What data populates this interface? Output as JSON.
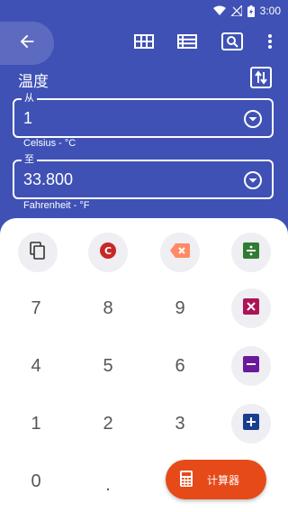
{
  "status": {
    "time": "3:00"
  },
  "title": "温度",
  "from": {
    "legend": "从",
    "value": "1",
    "unit": "Celsius - °C"
  },
  "to": {
    "legend": "至",
    "value": "33.800",
    "unit": "Fahrenheit - °F"
  },
  "keys": {
    "k7": "7",
    "k8": "8",
    "k9": "9",
    "k4": "4",
    "k5": "5",
    "k6": "6",
    "k1": "1",
    "k2": "2",
    "k3": "3",
    "k0": "0",
    "kdot": "."
  },
  "fab_label": "计算器",
  "colors": {
    "primary": "#3F51B5",
    "clear": "#C62828",
    "backspace": "#FF8A65",
    "divide": "#2E7D32",
    "multiply": "#AD1457",
    "minus": "#6A1B9A",
    "plus": "#1A3D8F",
    "fab": "#E64A19"
  }
}
